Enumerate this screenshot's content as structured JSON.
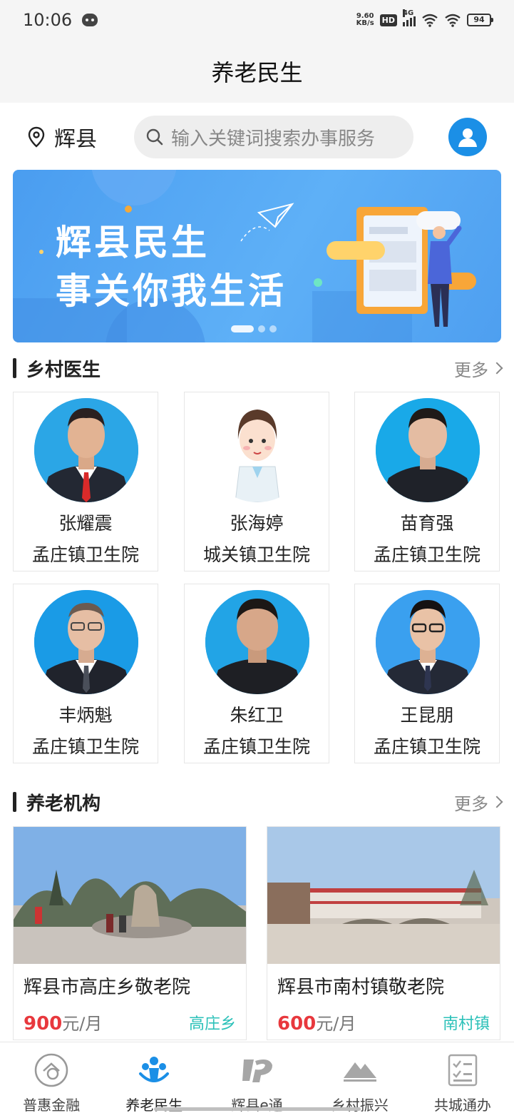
{
  "status_bar": {
    "time": "10:06",
    "speed_value": "9.60",
    "speed_unit": "KB/s",
    "hd": "HD",
    "network": "4G",
    "battery": "94"
  },
  "header": {
    "title": "养老民生"
  },
  "search": {
    "location": "辉县",
    "placeholder": "输入关键词搜索办事服务"
  },
  "banner": {
    "line1": "辉县民生",
    "line2": "事关你我生活"
  },
  "doctors_section": {
    "title": "乡村医生",
    "more": "更多",
    "doctors": [
      {
        "name": "张耀震",
        "hospital": "孟庄镇卫生院"
      },
      {
        "name": "张海婷",
        "hospital": "城关镇卫生院"
      },
      {
        "name": "苗育强",
        "hospital": "孟庄镇卫生院"
      },
      {
        "name": "丰炳魁",
        "hospital": "孟庄镇卫生院"
      },
      {
        "name": "朱红卫",
        "hospital": "孟庄镇卫生院"
      },
      {
        "name": "王昆朋",
        "hospital": "孟庄镇卫生院"
      }
    ]
  },
  "homes_section": {
    "title": "养老机构",
    "more": "更多",
    "homes": [
      {
        "name": "辉县市高庄乡敬老院",
        "price": "900",
        "unit": "元/月",
        "town": "高庄乡"
      },
      {
        "name": "辉县市南村镇敬老院",
        "price": "600",
        "unit": "元/月",
        "town": "南村镇"
      }
    ]
  },
  "tabbar": {
    "items": [
      {
        "label": "普惠金融",
        "icon": "finance-icon"
      },
      {
        "label": "养老民生",
        "icon": "people-care-icon",
        "active": true
      },
      {
        "label": "辉县e通",
        "icon": "hui-logo-icon"
      },
      {
        "label": "乡村振兴",
        "icon": "mountain-icon"
      },
      {
        "label": "共城通办",
        "icon": "checklist-icon"
      }
    ]
  },
  "colors": {
    "accent": "#1b8fe6",
    "price": "#e8383d",
    "town": "#2cc1b9"
  }
}
